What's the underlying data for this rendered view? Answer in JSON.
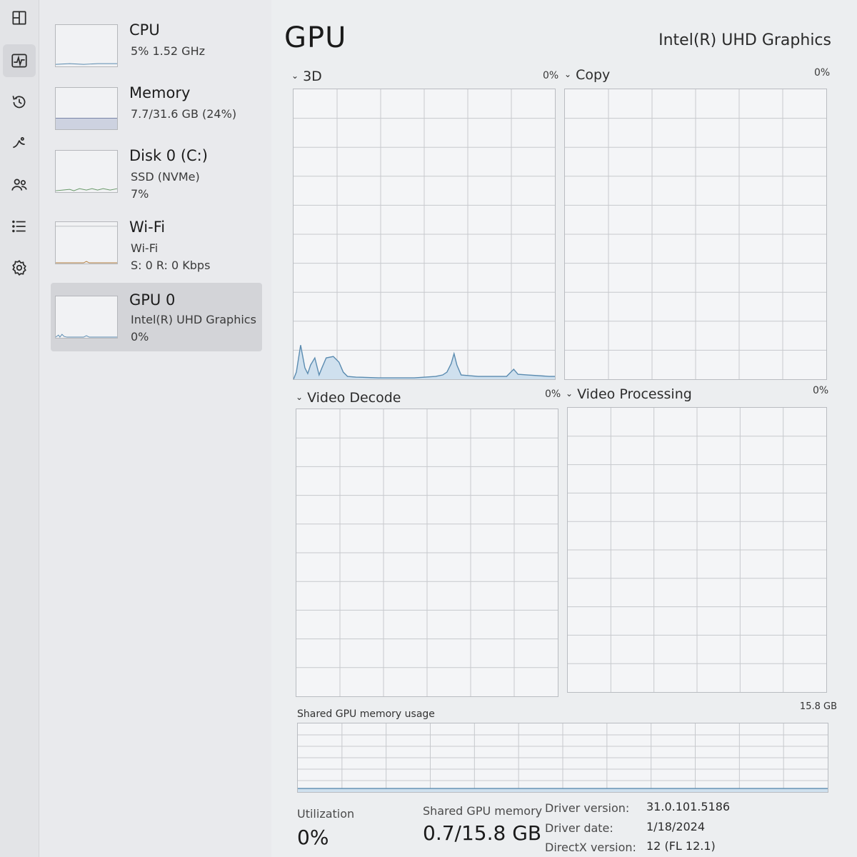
{
  "rail": {
    "items": [
      {
        "icon": "processes-icon",
        "active": false
      },
      {
        "icon": "performance-icon",
        "active": true
      },
      {
        "icon": "app-history-icon",
        "active": false
      },
      {
        "icon": "startup-apps-icon",
        "active": false
      },
      {
        "icon": "users-icon",
        "active": false
      },
      {
        "icon": "details-icon",
        "active": false
      },
      {
        "icon": "services-icon",
        "active": false
      }
    ]
  },
  "sidebar": {
    "devices": [
      {
        "title": "CPU",
        "lines": [
          "5%  1.52 GHz"
        ]
      },
      {
        "title": "Memory",
        "lines": [
          "7.7/31.6 GB (24%)"
        ]
      },
      {
        "title": "Disk 0 (C:)",
        "lines": [
          "SSD (NVMe)",
          "7%"
        ]
      },
      {
        "title": "Wi-Fi",
        "lines": [
          "Wi-Fi",
          "S: 0  R: 0 Kbps"
        ]
      },
      {
        "title": "GPU 0",
        "lines": [
          "Intel(R) UHD Graphics",
          "0%"
        ],
        "selected": true
      }
    ]
  },
  "header": {
    "title": "GPU",
    "adapter": "Intel(R) UHD Graphics"
  },
  "engines": [
    {
      "name": "3D",
      "value": "0%"
    },
    {
      "name": "Copy",
      "value": "0%"
    },
    {
      "name": "Video Decode",
      "value": "0%"
    },
    {
      "name": "Video Processing",
      "value": "0%"
    }
  ],
  "shared_memory": {
    "title": "Shared GPU memory usage",
    "max": "15.8 GB"
  },
  "stats": {
    "utilization_label": "Utilization",
    "utilization_value": "0%",
    "shared_label": "Shared GPU memory",
    "shared_value": "0.7/15.8 GB"
  },
  "info": {
    "driver_version_label": "Driver version:",
    "driver_version": "31.0.101.5186",
    "driver_date_label": "Driver date:",
    "driver_date": "1/18/2024",
    "directx_label": "DirectX version:",
    "directx": "12 (FL 12.1)"
  },
  "colors": {
    "line": "#5a8bb0",
    "fill": "#cfe0ee",
    "grid": "#c7c9cd"
  }
}
